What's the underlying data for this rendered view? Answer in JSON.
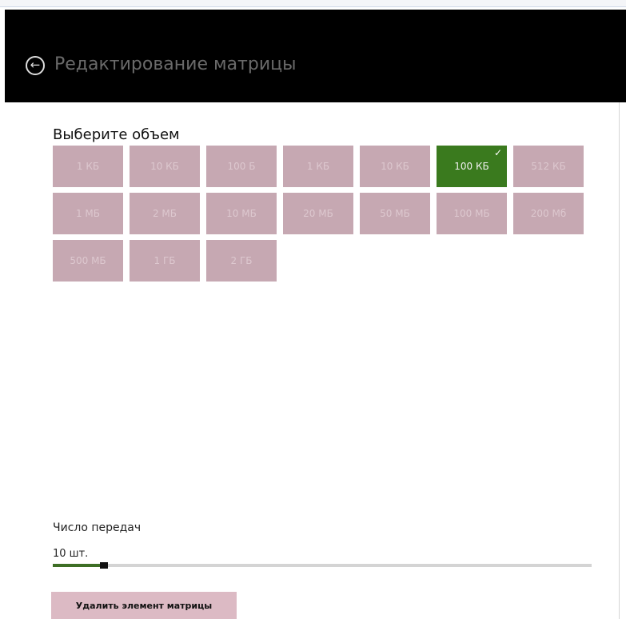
{
  "header": {
    "back_icon": "arrow-left-circle-icon",
    "title": "Редактирование матрицы"
  },
  "size_section": {
    "title": "Выберите объем",
    "selected_index": 5,
    "colors": {
      "tile": "#c6a8b2",
      "selected": "#3a7a1e"
    },
    "options": [
      "1 КБ",
      "10 КБ",
      "100 Б",
      "1 КБ",
      "10 КБ",
      "100 КБ",
      "512 КБ",
      "1 МБ",
      "2 МБ",
      "10 МБ",
      "20 МБ",
      "50 МБ",
      "100 МБ",
      "200 Мб",
      "500 МБ",
      "1 ГБ",
      "2 ГБ"
    ]
  },
  "transfers": {
    "label": "Число передач",
    "value": "10 шт.",
    "fraction": 0.095
  },
  "actions": {
    "delete_label": "Удалить элемент матрицы"
  }
}
